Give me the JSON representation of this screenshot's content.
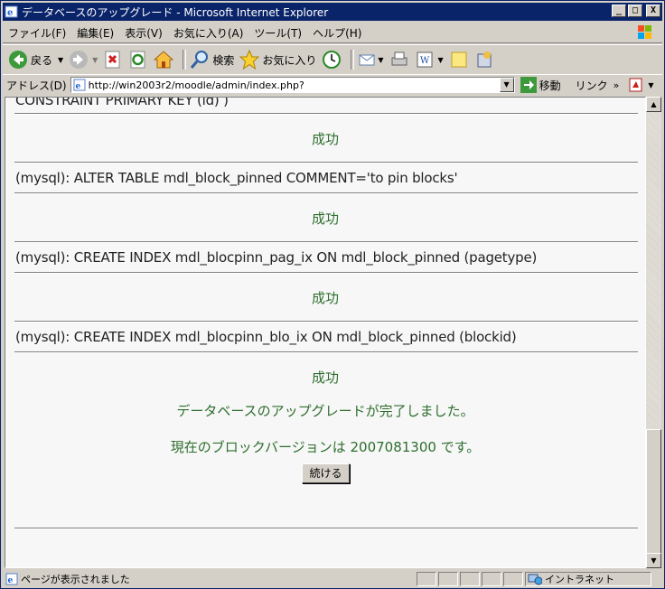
{
  "window": {
    "title": "データベースのアップグレード - Microsoft Internet Explorer",
    "buttons": {
      "minimize": "_",
      "maximize": "□",
      "close": "X"
    }
  },
  "menu": {
    "items": [
      "ファイル(F)",
      "編集(E)",
      "表示(V)",
      "お気に入り(A)",
      "ツール(T)",
      "ヘルプ(H)"
    ]
  },
  "toolbar": {
    "back_label": "戻る",
    "search_label": "検索",
    "favorites_label": "お気に入り"
  },
  "address_bar": {
    "label": "アドレス(D)",
    "url": "http://win2003r2/moodle/admin/index.php?",
    "go_label": "移動",
    "links_label": "リンク"
  },
  "content": {
    "top_partial": "CONSTRAINT PRIMARY KEY (id) )",
    "entries": [
      {
        "result": "成功"
      },
      {
        "sql": "(mysql): ALTER TABLE mdl_block_pinned COMMENT='to pin blocks'",
        "result": "成功"
      },
      {
        "sql": "(mysql): CREATE INDEX mdl_blocpinn_pag_ix ON mdl_block_pinned (pagetype)",
        "result": "成功"
      },
      {
        "sql": "(mysql): CREATE INDEX mdl_blocpinn_blo_ix ON mdl_block_pinned (blockid)",
        "result": "成功"
      }
    ],
    "complete_message": "データベースのアップグレードが完了しました。",
    "version_message": "現在のブロックバージョンは 2007081300 です。",
    "continue_button": "続ける"
  },
  "status_bar": {
    "text": "ページが表示されました",
    "zone": "イントラネット"
  }
}
